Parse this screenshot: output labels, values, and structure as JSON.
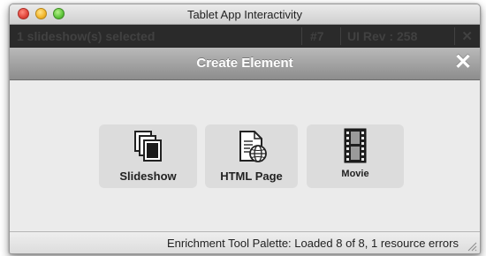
{
  "window": {
    "title": "Tablet App Interactivity"
  },
  "darkbar": {
    "selection": "1 slideshow(s) selected",
    "number": "#7",
    "ui_rev": "UI Rev : 258",
    "close_glyph": "✕"
  },
  "dialog": {
    "title": "Create Element",
    "close_glyph": "✕"
  },
  "elements": [
    {
      "label": "Slideshow",
      "icon": "slideshow-icon"
    },
    {
      "label": "HTML Page",
      "icon": "html-page-icon"
    },
    {
      "label": "Movie",
      "icon": "movie-icon"
    }
  ],
  "status": {
    "text": "Enrichment Tool Palette:  Loaded 8 of 8, 1 resource errors"
  },
  "colors": {
    "dark_bar": "#2a2a2a",
    "header_gray": "#8d8d8d",
    "tile_bg": "#dcdcdc"
  }
}
